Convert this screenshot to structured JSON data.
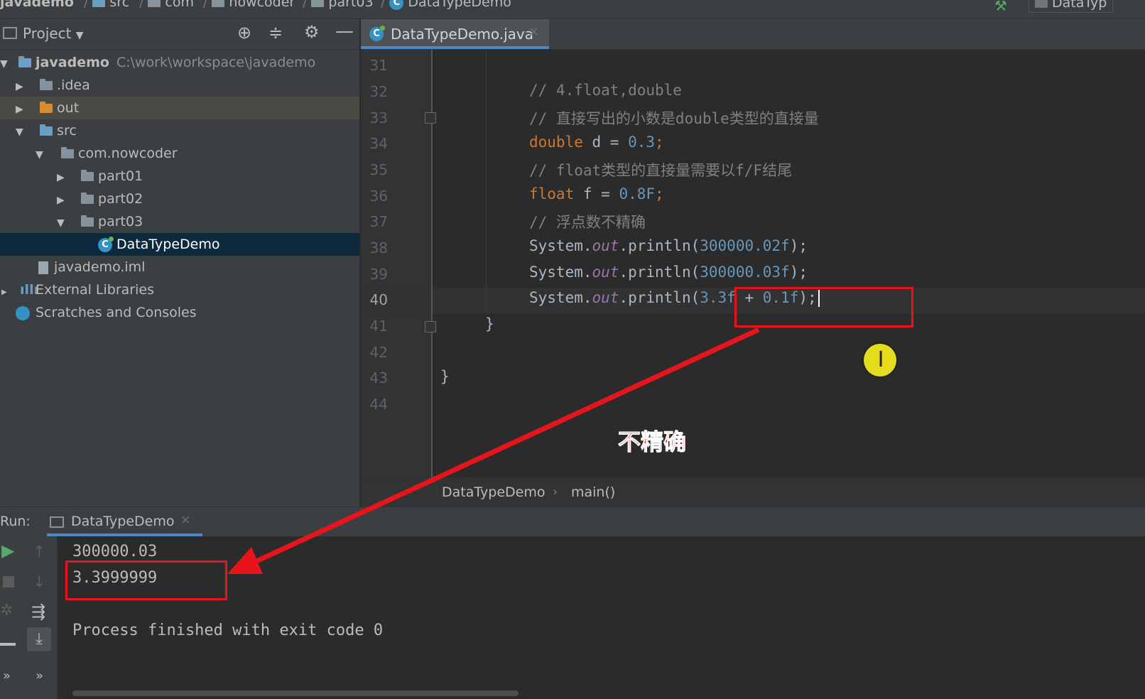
{
  "breadcrumbs": [
    "javademo",
    "src",
    "com",
    "nowcoder",
    "part03",
    "DataTypeDemo"
  ],
  "navbar_right_label": "DataTyp",
  "project_panel": {
    "title": "Project",
    "tree": [
      {
        "label": "javademo",
        "path": "C:\\work\\workspace\\javademo"
      },
      {
        "label": ".idea"
      },
      {
        "label": "out"
      },
      {
        "label": "src"
      },
      {
        "label": "com.nowcoder"
      },
      {
        "label": "part01"
      },
      {
        "label": "part02"
      },
      {
        "label": "part03"
      },
      {
        "label": "DataTypeDemo"
      },
      {
        "label": "javademo.iml"
      },
      {
        "label": "External Libraries"
      },
      {
        "label": "Scratches and Consoles"
      }
    ]
  },
  "editor": {
    "tab_label": "DataTypeDemo.java",
    "line_numbers": [
      "31",
      "32",
      "33",
      "34",
      "35",
      "36",
      "37",
      "38",
      "39",
      "40",
      "41",
      "42",
      "43",
      "44"
    ],
    "current_line": "40",
    "code": {
      "l32": "// 4.float,double",
      "l33": "// 直接写出的小数是double类型的直接量",
      "l34_kw": "double",
      "l34_var": " d = ",
      "l34_num": "0.3",
      "l34_end": ";",
      "l35": "// float类型的直接量需要以f/F结尾",
      "l36_kw": "float",
      "l36_var": " f = ",
      "l36_num": "0.8F",
      "l36_end": ";",
      "l37": "// 浮点数不精确",
      "l38_a": "System.",
      "l38_b": "out",
      "l38_c": ".println(",
      "l38_num": "300000.02f",
      "l38_end": ");",
      "l39_a": "System.",
      "l39_b": "out",
      "l39_c": ".println(",
      "l39_num": "300000.03f",
      "l39_end": ");",
      "l40_a": "System.",
      "l40_b": "out",
      "l40_c": ".println(",
      "l40_num1": "3.3f",
      "l40_op": " + ",
      "l40_num2": "0.1f",
      "l40_end": ");",
      "l41": "}",
      "l43": "}"
    },
    "breadcrumb_class": "DataTypeDemo",
    "breadcrumb_method": "main()"
  },
  "run": {
    "label": "Run:",
    "tab_label": "DataTypeDemo",
    "output": [
      "300000.03",
      "3.3999999",
      "",
      "Process finished with exit code 0"
    ]
  },
  "annotation": {
    "label": "不精确",
    "color": "#e8141b"
  },
  "colors": {
    "keyword": "#cc7832",
    "number": "#6897bb",
    "comment": "#808080",
    "static_field": "#9876aa",
    "selection": "#0d293e"
  }
}
